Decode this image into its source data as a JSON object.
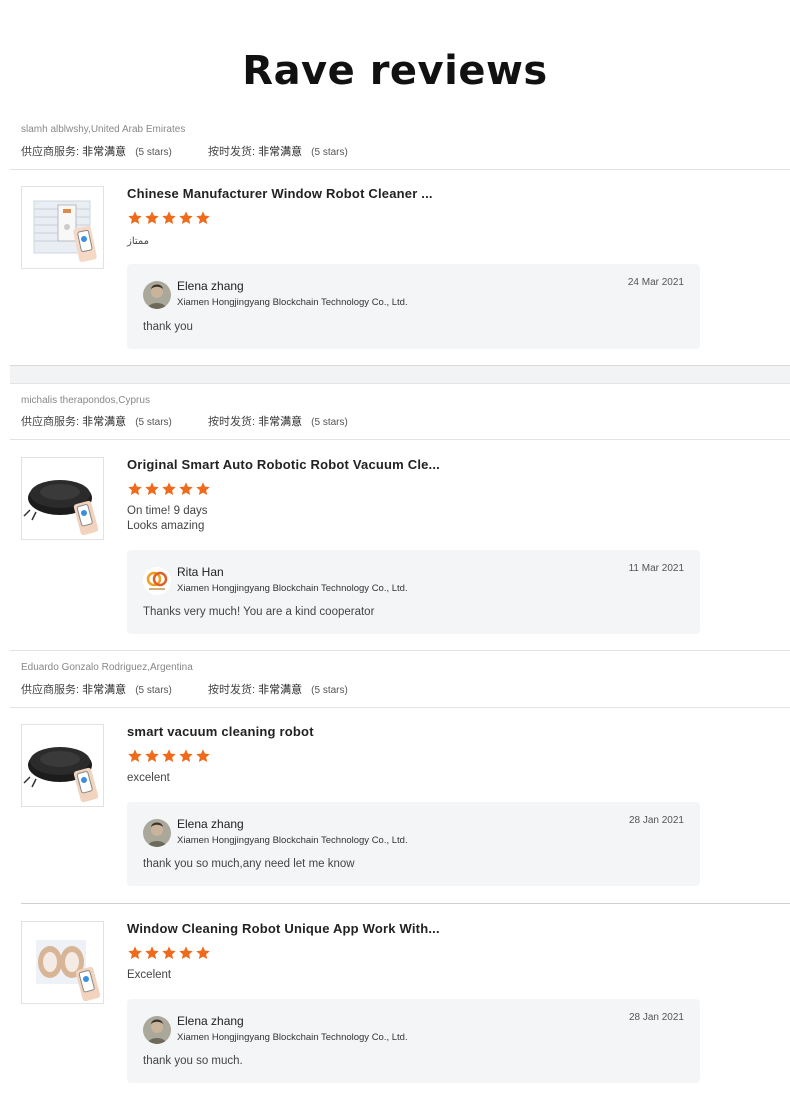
{
  "title": "Rave reviews",
  "star_color": "#f06a1c",
  "reviews": [
    {
      "reviewer": "slamh alblwshy,United Arab Emirates",
      "service_label": "供应商服务:",
      "service_value": "非常满意",
      "service_stars": "(5 stars)",
      "shipping_label": "按时发货:",
      "shipping_value": "非常满意",
      "shipping_stars": "(5 stars)",
      "items": [
        {
          "product": "Chinese Manufacturer Window Robot Cleaner ...",
          "rating": 5,
          "comment": "ممتاز",
          "reply": {
            "name": "Elena zhang",
            "company": "Xiamen Hongjingyang Blockchain Technology Co., Ltd.",
            "date": "24 Mar 2021",
            "text": "thank you"
          }
        }
      ]
    },
    {
      "reviewer": "michalis therapondos,Cyprus",
      "service_label": "供应商服务:",
      "service_value": "非常满意",
      "service_stars": "(5 stars)",
      "shipping_label": "按时发货:",
      "shipping_value": "非常满意",
      "shipping_stars": "(5 stars)",
      "items": [
        {
          "product": "Original Smart Auto Robotic Robot Vacuum Cle...",
          "rating": 5,
          "comment_line1": "On time! 9 days",
          "comment_line2": "Looks amazing",
          "reply": {
            "name": "Rita Han",
            "company": "Xiamen Hongjingyang Blockchain Technology Co., Ltd.",
            "date": "11 Mar 2021",
            "text": "Thanks very much! You are a kind cooperator"
          }
        }
      ]
    },
    {
      "reviewer": "Eduardo Gonzalo Rodriguez,Argentina",
      "service_label": "供应商服务:",
      "service_value": "非常满意",
      "service_stars": "(5 stars)",
      "shipping_label": "按时发货:",
      "shipping_value": "非常满意",
      "shipping_stars": "(5 stars)",
      "items": [
        {
          "product": "smart vacuum cleaning robot",
          "rating": 5,
          "comment": "excelent",
          "reply": {
            "name": "Elena zhang",
            "company": "Xiamen Hongjingyang Blockchain Technology Co., Ltd.",
            "date": "28 Jan 2021",
            "text": "thank you so much,any need let me know"
          }
        },
        {
          "product": "Window Cleaning Robot Unique App Work With...",
          "rating": 5,
          "comment": "Excelent",
          "reply": {
            "name": "Elena zhang",
            "company": "Xiamen Hongjingyang Blockchain Technology Co., Ltd.",
            "date": "28 Jan 2021",
            "text": "thank you so much."
          }
        }
      ]
    }
  ]
}
